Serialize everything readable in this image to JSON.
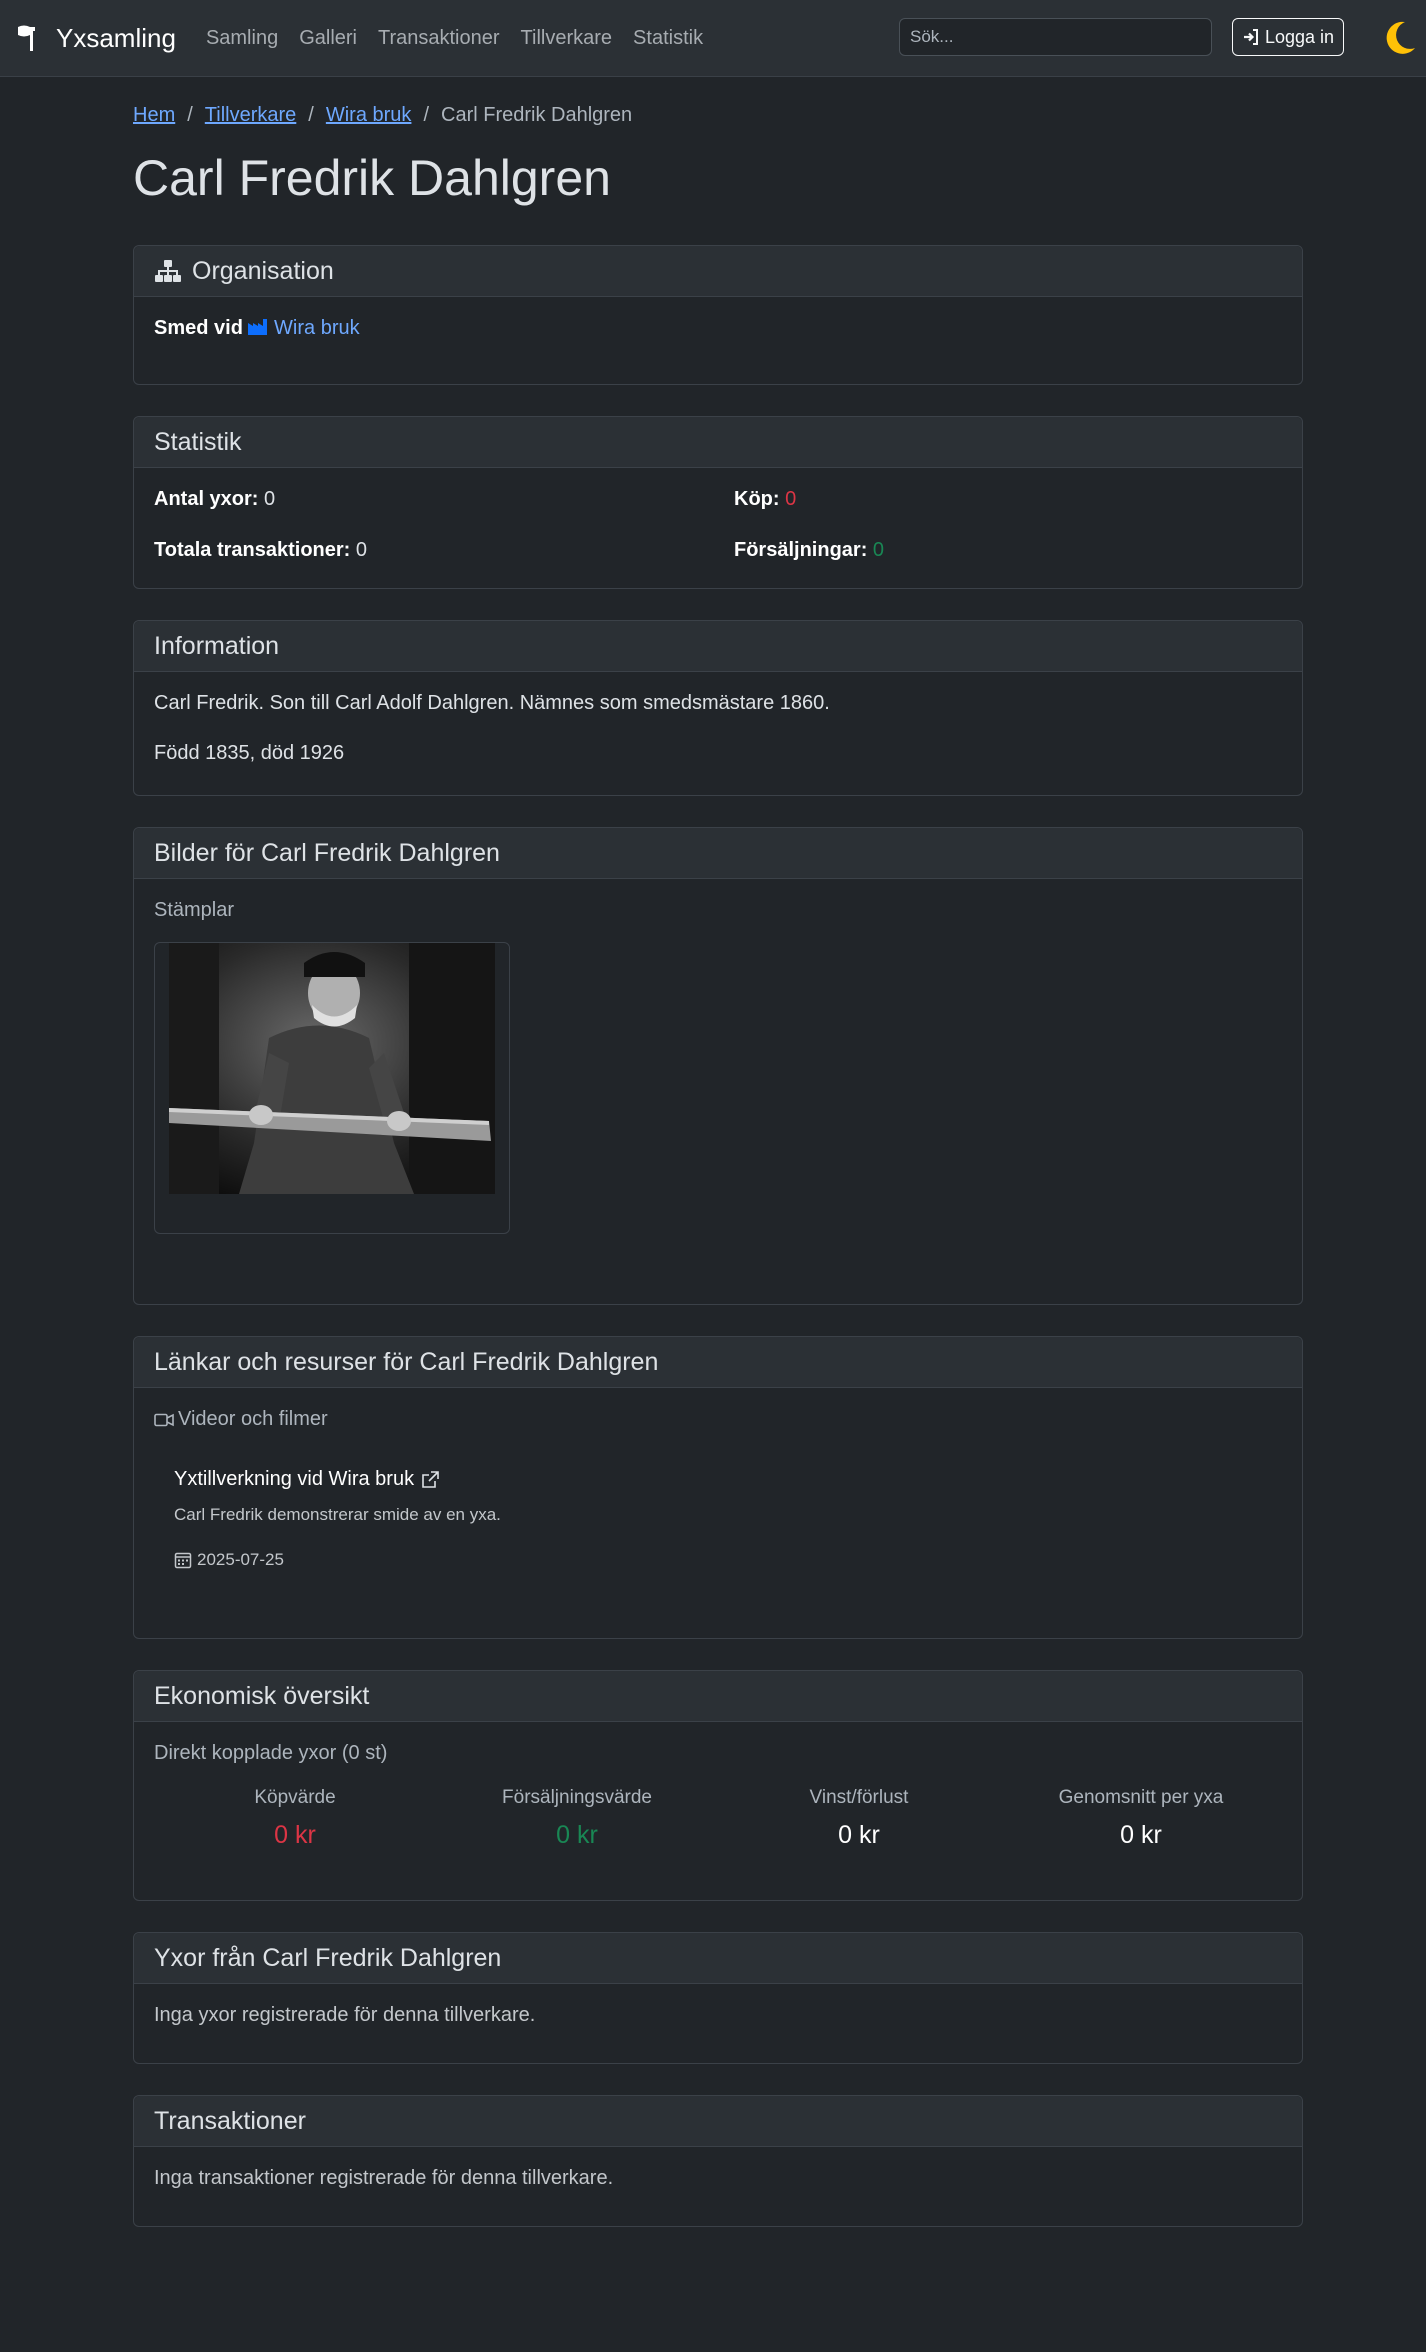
{
  "nav": {
    "brand": "Yxsamling",
    "links": [
      "Samling",
      "Galleri",
      "Transaktioner",
      "Tillverkare",
      "Statistik"
    ],
    "search_placeholder": "Sök...",
    "login_label": "Logga in"
  },
  "breadcrumb": {
    "home": "Hem",
    "manufacturers": "Tillverkare",
    "org": "Wira bruk",
    "current": "Carl Fredrik Dahlgren"
  },
  "page_title": "Carl Fredrik Dahlgren",
  "organisation": {
    "header": "Organisation",
    "label": "Smed vid",
    "link": "Wira bruk"
  },
  "statistics": {
    "header": "Statistik",
    "axes_label": "Antal yxor:",
    "axes_value": "0",
    "buy_label": "Köp:",
    "buy_value": "0",
    "total_label": "Totala transaktioner:",
    "total_value": "0",
    "sales_label": "Försäljningar:",
    "sales_value": "0"
  },
  "information": {
    "header": "Information",
    "text1": "Carl Fredrik. Son till Carl Adolf Dahlgren. Nämnes som smedsmästare 1860.",
    "text2": "Född 1835, död 1926"
  },
  "images": {
    "header": "Bilder för Carl Fredrik Dahlgren",
    "section": "Stämplar"
  },
  "links": {
    "header": "Länkar och resurser för Carl Fredrik Dahlgren",
    "section": "Videor och filmer",
    "title": "Yxtillverkning vid Wira bruk",
    "description": "Carl Fredrik demonstrerar smide av en yxa.",
    "date": "2025-07-25"
  },
  "economy": {
    "header": "Ekonomisk översikt",
    "subtitle": "Direkt kopplade yxor (0 st)",
    "purchase_label": "Köpvärde",
    "purchase_value": "0 kr",
    "sales_label": "Försäljningsvärde",
    "sales_value": "0 kr",
    "profit_label": "Vinst/förlust",
    "profit_value": "0 kr",
    "avg_label": "Genomsnitt per yxa",
    "avg_value": "0 kr",
    "colors": {
      "purchase": "#dc3545",
      "sales": "#198754"
    }
  },
  "axes": {
    "header": "Yxor från Carl Fredrik Dahlgren",
    "empty": "Inga yxor registrerade för denna tillverkare."
  },
  "transactions": {
    "header": "Transaktioner",
    "empty": "Inga transaktioner registrerade för denna tillverkare."
  },
  "icons": [
    "axe-icon",
    "login-icon",
    "moon-icon",
    "sitemap-icon",
    "factory-icon",
    "video-icon",
    "external-link-icon",
    "calendar-icon"
  ]
}
